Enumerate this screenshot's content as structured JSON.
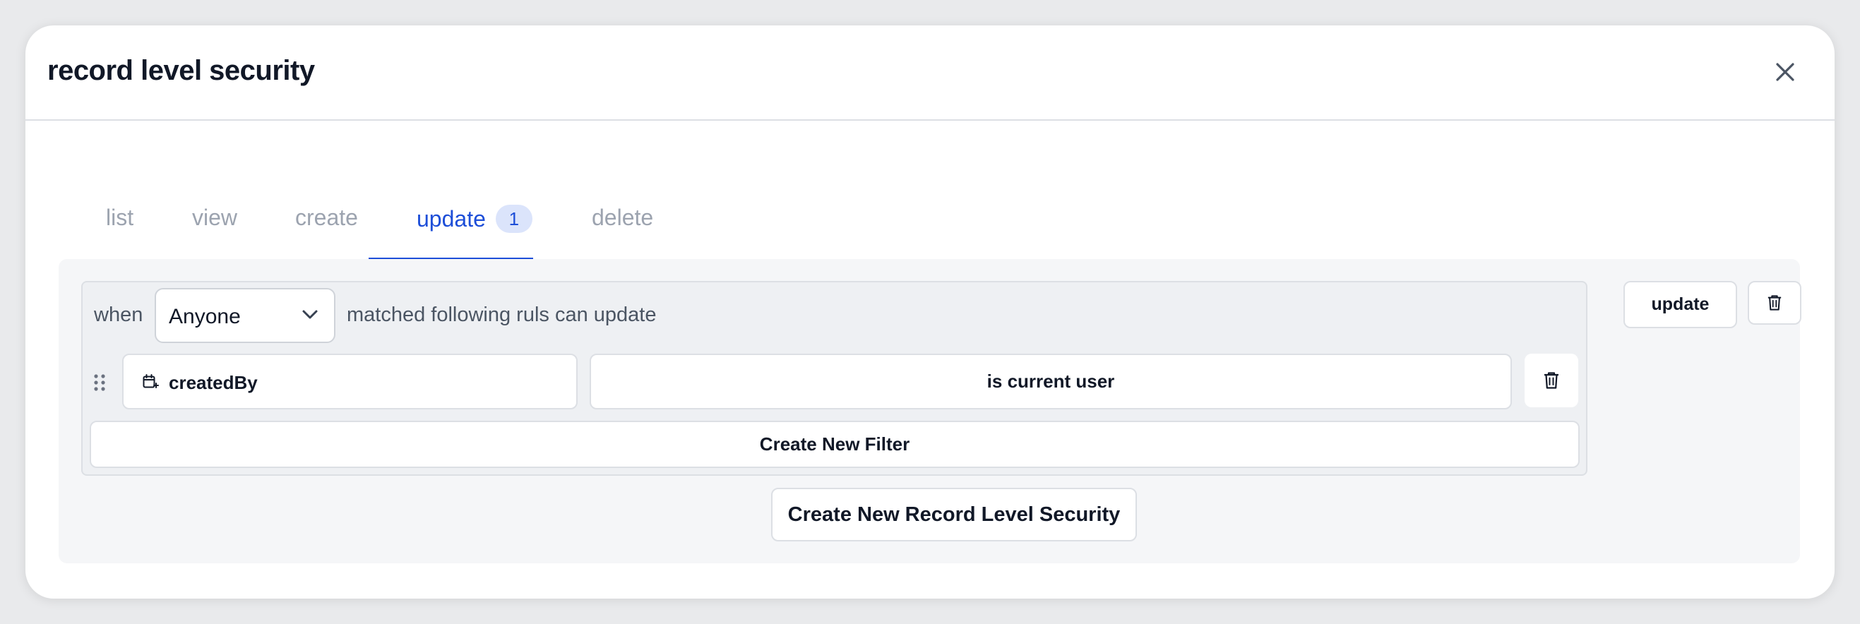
{
  "modal": {
    "title": "record level security"
  },
  "tabs": [
    {
      "label": "list",
      "active": false
    },
    {
      "label": "view",
      "active": false
    },
    {
      "label": "create",
      "active": false
    },
    {
      "label": "update",
      "active": true,
      "badge": "1"
    },
    {
      "label": "delete",
      "active": false
    }
  ],
  "rule": {
    "when_label": "when",
    "role_value": "Anyone",
    "matched_text": "matched following ruls can update",
    "filter": {
      "field": "createdBy",
      "operator": "is current user"
    },
    "create_filter_label": "Create New Filter",
    "update_label": "update"
  },
  "create_rls_label": "Create New Record Level Security",
  "icons": {
    "close": "close-icon",
    "chevron": "chevron-down-icon",
    "drag": "drag-handle-icon",
    "field": "calendar-icon",
    "trash": "trash-icon"
  },
  "colors": {
    "accent": "#1d4ed8",
    "badge_bg": "#dbe4fb",
    "inactive_tab": "#9ca3af",
    "panel_bg": "#f5f6f8"
  }
}
